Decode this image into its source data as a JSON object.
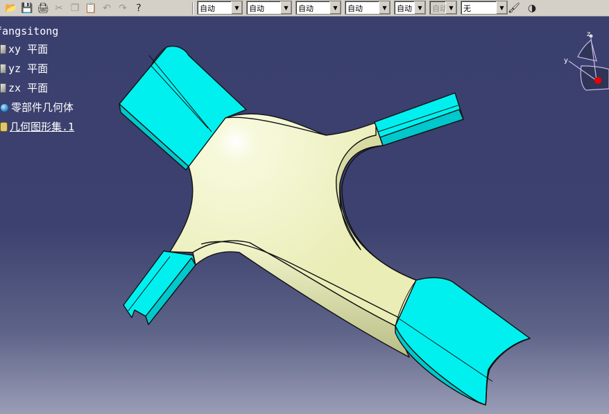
{
  "window": {
    "title": ""
  },
  "toolbar": {
    "buttons": [
      {
        "name": "open-folder-icon",
        "glyph": "📂",
        "enabled": true
      },
      {
        "name": "save-icon",
        "glyph": "💾",
        "enabled": true
      },
      {
        "name": "print-icon",
        "glyph": "🖨",
        "enabled": true
      },
      {
        "name": "cut-icon",
        "glyph": "✂",
        "enabled": false
      },
      {
        "name": "copy-icon",
        "glyph": "❐",
        "enabled": false
      },
      {
        "name": "paste-icon",
        "glyph": "📋",
        "enabled": true
      },
      {
        "name": "undo-icon",
        "glyph": "↶",
        "enabled": false
      },
      {
        "name": "redo-icon",
        "glyph": "↷",
        "enabled": false
      },
      {
        "name": "whats-this-help-icon",
        "glyph": "?",
        "enabled": true
      }
    ],
    "combos": [
      {
        "name": "color-combo",
        "value": "自动",
        "enabled": true
      },
      {
        "name": "transparency-combo",
        "value": "自动",
        "enabled": true
      },
      {
        "name": "line-thickness-combo",
        "value": "自动",
        "enabled": true
      },
      {
        "name": "line-type-combo",
        "value": "自动",
        "enabled": true
      },
      {
        "name": "point-symbol-combo",
        "value": "自动",
        "enabled": true
      },
      {
        "name": "rendering-style-combo",
        "value": "自动",
        "enabled": false
      },
      {
        "name": "layer-combo",
        "value": "无",
        "enabled": true
      }
    ],
    "trailing_buttons": [
      {
        "name": "format-painter-icon",
        "glyph": "🖌"
      },
      {
        "name": "graphic-properties-icon",
        "glyph": "◑"
      }
    ]
  },
  "tree": {
    "root": "fangsitong",
    "items": [
      {
        "name": "tree-item-xy-plane",
        "label": "xy 平面",
        "icon": "plane"
      },
      {
        "name": "tree-item-yz-plane",
        "label": "yz 平面",
        "icon": "plane"
      },
      {
        "name": "tree-item-zx-plane",
        "label": "zx 平面",
        "icon": "plane"
      },
      {
        "name": "tree-item-part-body",
        "label": "零部件几何体",
        "icon": "body"
      },
      {
        "name": "tree-item-geometric-set",
        "label": "几何图形集.1",
        "icon": "geo"
      }
    ]
  },
  "compass": {
    "labels": {
      "z": "z",
      "y": "y"
    }
  },
  "colors": {
    "background": "#3c416f",
    "cap_cyan": "#00f0f0",
    "surface_cream": "#f0f4c2"
  }
}
